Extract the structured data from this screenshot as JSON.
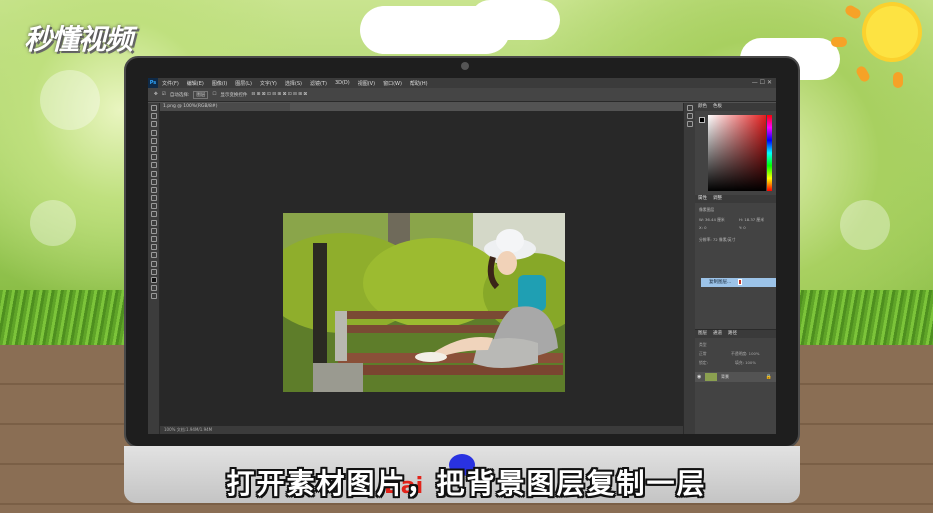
{
  "logo": {
    "text": "秒懂视频"
  },
  "caption": "打开素材图片，把背景图层复制一层",
  "watermark": {
    "text": "Bai"
  },
  "photoshop": {
    "app_icon": "Ps",
    "menu": [
      "文件(F)",
      "编辑(E)",
      "图像(I)",
      "图层(L)",
      "文字(Y)",
      "选择(S)",
      "滤镜(T)",
      "3D(D)",
      "视图(V)",
      "窗口(W)",
      "帮助(H)"
    ],
    "window_controls": "— ☐ ✕",
    "options_bar": {
      "auto_select": "自动选择:",
      "target": "图层",
      "transform": "显示变换控件"
    },
    "doc_tab": "1.png @ 100%(RGB/8#)",
    "status_bar": "100%    文档:1.94M/1.94M",
    "panels": {
      "color_tabs": [
        "颜色",
        "色板"
      ],
      "properties_tabs": [
        "属性",
        "调整"
      ],
      "properties_title": "像素图层",
      "prop_w": "W: 36.44 厘米",
      "prop_h": "H: 18.37 厘米",
      "prop_x": "X: 0",
      "prop_y": "Y: 0",
      "prop_mode": "分辨率: 72 像素/英寸",
      "popup_item": "复制图层...",
      "layers_tabs": [
        "图层",
        "通道",
        "路径"
      ],
      "layer_kind": "类型",
      "layer_blend": "正常",
      "layer_opacity": "不透明度: 100%",
      "layer_lock": "锁定:",
      "layer_fill": "填充: 100%",
      "layer_name": "背景"
    }
  },
  "colors": {
    "accent": "#31a8ff",
    "highlight": "#9cc3e8",
    "brand_red": "#e2231a"
  }
}
